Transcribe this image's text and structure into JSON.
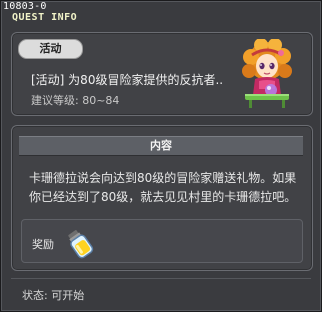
{
  "window": {
    "quest_id": "10803-0",
    "title": "QUEST INFO"
  },
  "quest": {
    "tag": "活动",
    "name": "[活动] 为80级冒险家提供的反抗者..",
    "recommended_level": "建议等级: 80~84"
  },
  "content": {
    "header": "内容",
    "description": "卡珊德拉说会向达到80级的冒险家赠送礼物。如果你已经达到了80级，就去见见村里的卡珊德拉吧。",
    "reward_label": "奖励"
  },
  "status": {
    "text": "状态: 可开始"
  },
  "icons": {
    "npc": "npc-portrait-icon",
    "reward": "potion-item-icon"
  },
  "colors": {
    "window_bg": "#3a3b3f",
    "title_text": "#f1f3c8",
    "tag_bg": "#dcdcdc"
  }
}
